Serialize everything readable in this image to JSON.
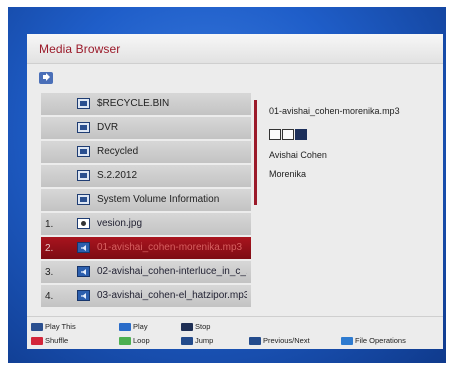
{
  "app": {
    "title": "Media Browser"
  },
  "files": [
    {
      "num": "",
      "type": "folder",
      "label": "$RECYCLE.BIN",
      "selected": false
    },
    {
      "num": "",
      "type": "folder",
      "label": "DVR",
      "selected": false
    },
    {
      "num": "",
      "type": "folder",
      "label": "Recycled",
      "selected": false
    },
    {
      "num": "",
      "type": "folder",
      "label": "S.2.2012",
      "selected": false
    },
    {
      "num": "",
      "type": "folder",
      "label": "System Volume Information",
      "selected": false
    },
    {
      "num": "1.",
      "type": "image",
      "label": "vesion.jpg",
      "selected": false
    },
    {
      "num": "2.",
      "type": "audio",
      "label": "01-avishai_cohen-morenika.mp3",
      "selected": true
    },
    {
      "num": "3.",
      "type": "audio",
      "label": "02-avishai_cohen-interluce_in_c_...",
      "selected": false
    },
    {
      "num": "4.",
      "type": "audio",
      "label": "03-avishai_cohen-el_hatzipor.mp3",
      "selected": false
    }
  ],
  "info": {
    "filename": "01-avishai_cohen-morenika.mp3",
    "artist": "Avishai Cohen",
    "album": "Morenika"
  },
  "footer": {
    "play_this": "Play This",
    "play": "Play",
    "stop": "Stop",
    "shuffle": "Shuffle",
    "loop": "Loop",
    "jump": "Jump",
    "prev_next": "Previous/Next",
    "file_ops": "File Operations"
  },
  "colors": {
    "accent": "#9b1a2a",
    "selected_row": "#a9141e",
    "frame_blue": "#1f5ec9"
  }
}
